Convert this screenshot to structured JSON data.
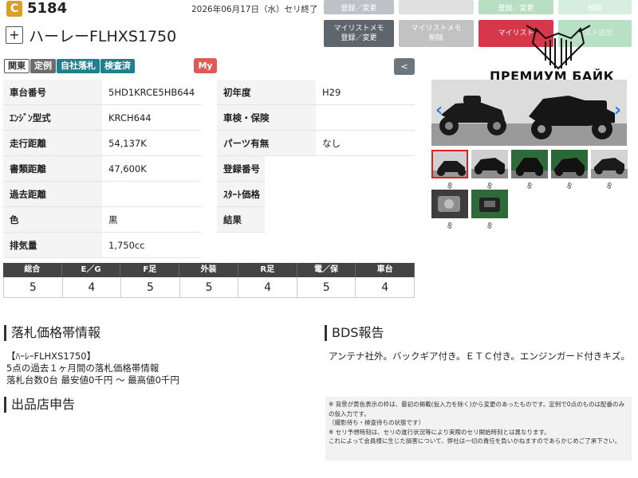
{
  "header": {
    "grade_letter": "C",
    "lot_number": "5184",
    "date": "2026年06月17日（水）セリ終了",
    "plus": "+",
    "model": "ハーレーFLHXS1750"
  },
  "top_buttons": {
    "row1": [
      "登録／変更",
      "",
      "登録／変更",
      "削除"
    ],
    "memo": "マイリストメモ\n登録／変更",
    "memo_disabled": "マイリストメモ\n削除",
    "mylist": "マイリスト",
    "list_add": "リスト追加"
  },
  "tags": [
    "関東",
    "定例",
    "自社落札",
    "検査済"
  ],
  "my_badge": "My",
  "back_label": "<",
  "specs": [
    {
      "label": "車台番号",
      "value": "5HD1KRCE5HB644",
      "label2": "初年度",
      "value2": "H29"
    },
    {
      "label": "ｴﾝｼﾞﾝ型式",
      "value": "KRCH644",
      "label2": "車検・保険",
      "value2": ""
    },
    {
      "label": "走行距離",
      "value": "54,137K",
      "label2": "パーツ有無",
      "value2": "なし"
    },
    {
      "label": "書類距離",
      "value": "47,600K",
      "label2": "登録番号",
      "value2": ""
    },
    {
      "label": "過去距離",
      "value": "",
      "label2": "ｽﾀｰﾄ価格",
      "value2": ""
    },
    {
      "label": "色",
      "value": "黒",
      "label2": "結果",
      "value2": ""
    },
    {
      "label": "排気量",
      "value": "1,750cc"
    }
  ],
  "grades": {
    "headers": [
      "総合",
      "E／G",
      "F足",
      "外装",
      "R足",
      "電／保",
      "車台"
    ],
    "values": [
      "5",
      "4",
      "5",
      "5",
      "4",
      "5",
      "4"
    ]
  },
  "price_section": {
    "title": "落札価格帯情報",
    "model_line": "【ﾊｰﾚｰFLHXS1750】",
    "line2": "5点の過去１ヶ月間の落札価格帯情報",
    "line3": "落札台数0台 最安値0千円 〜 最高値0千円"
  },
  "seller_section": {
    "title": "出品店申告"
  },
  "bds_section": {
    "title": "BDS報告",
    "text": "アンテナ社外。バックギア付き。ＥＴＣ付き。エンジンガード付きキズ。"
  },
  "notes": [
    "※ 背景が黄色表示の枠は、最初の掲載(仮入力を除く)から変更のあったものです。定例で0点のものは配番のみの仮入力です。",
    "（撮影待ち・検査待ちの状態です）",
    "※ セリ予想時刻は、セリの進行状況等により実際のセリ開始時刻とは異なります。",
    "これによって会員様に生じた損害について、弊社は一切の責任を負いかねますのであらかじめご了承下さい。"
  ],
  "watermark": "ПРЕМИУМ БАЙК",
  "colors": {
    "grade_badge": "#d9a028",
    "tag_teal": "#1d7f8f",
    "tag_gray": "#6c6c6c",
    "my_red": "#e05a55",
    "mylist_red": "#d6384a",
    "memo_gray": "#5e656c",
    "grade_header": "#444444"
  }
}
